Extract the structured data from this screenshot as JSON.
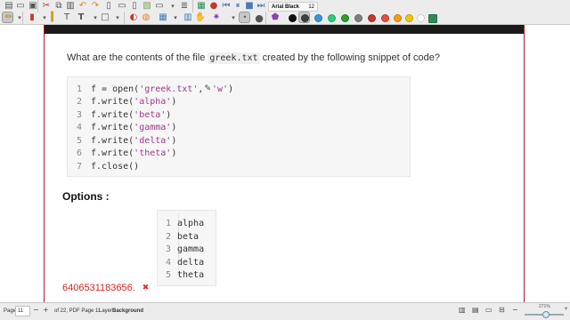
{
  "toolbar": {
    "font_family": "Arial Black",
    "font_size": "12",
    "accent_color": "#3a7d44",
    "icons": [
      "pencil-icon",
      "marker-icon",
      "eraser-icon",
      "clipboard-icon",
      "cut-icon",
      "copy-icon",
      "paste-icon",
      "undo-icon",
      "redo-icon",
      "new-page-icon",
      "add-page-icon",
      "image-icon",
      "record-icon",
      "previous-icon",
      "play-icon",
      "pause-icon",
      "stop-icon",
      "grid-icon",
      "highlighter-icon",
      "text-icon",
      "text-box-icon",
      "shape-icon",
      "pen-tool-icon",
      "color-wheel-icon",
      "fill-icon",
      "background-icon",
      "lines-icon",
      "hand-icon",
      "laser-pointer-icon",
      "shade-icon",
      "dot-icon"
    ],
    "colors": [
      "#111111",
      "#3f3f3f",
      "#9b59b6",
      "#2ca02c",
      "#3498db",
      "#2ecc71",
      "#7f7f7f",
      "#c0392b",
      "#e74c3c",
      "#f39c12",
      "#f1c40f",
      "#ffffff",
      "#2e8b57"
    ]
  },
  "document": {
    "question_prefix": "What are the contents of the file",
    "question_file": "greek.txt",
    "question_suffix": "created by the following snippet of code?",
    "code_lines": [
      {
        "n": "1",
        "before": "f = open(",
        "str1": "'greek.txt'",
        "mid": ", ",
        "cursor": "✎",
        "str2": "'w'",
        "after": ")"
      },
      {
        "n": "2",
        "before": "f.write(",
        "str1": "'alpha'",
        "after": ")"
      },
      {
        "n": "3",
        "before": "f.write(",
        "str1": "'beta'",
        "after": ")"
      },
      {
        "n": "4",
        "before": "f.write(",
        "str1": "'gamma'",
        "after": ")"
      },
      {
        "n": "5",
        "before": "f.write(",
        "str1": "'delta'",
        "after": ")"
      },
      {
        "n": "6",
        "before": "f.write(",
        "str1": "'theta'",
        "after": ")"
      },
      {
        "n": "7",
        "before": "f.close()"
      }
    ],
    "options_heading": "Options :",
    "answer_lines": [
      {
        "n": "1",
        "text": "alpha"
      },
      {
        "n": "2",
        "text": "beta"
      },
      {
        "n": "3",
        "text": "gamma"
      },
      {
        "n": "4",
        "text": "delta"
      },
      {
        "n": "5",
        "text": "theta"
      }
    ],
    "answer_id": "6406531183656.",
    "wrong_mark": "✖"
  },
  "statusbar": {
    "page_label": "Page",
    "page_number": "11",
    "page_of": "of 22, PDF Page 11",
    "layer_label": "Layer",
    "layer_value": "Background",
    "zoom_level": "271%"
  }
}
